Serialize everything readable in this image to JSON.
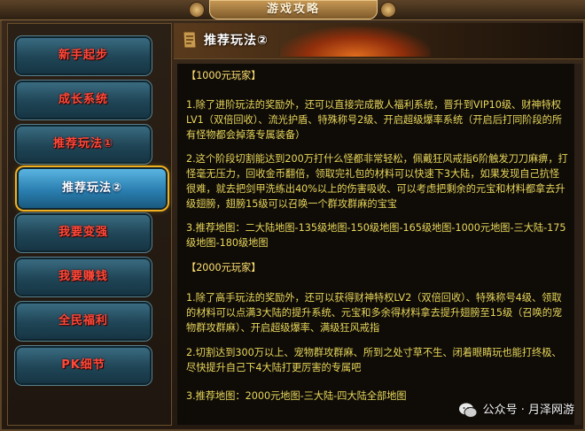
{
  "window": {
    "title": "游戏攻略"
  },
  "sidebar": {
    "items": [
      {
        "label": "新手起步",
        "active": false
      },
      {
        "label": "成长系统",
        "active": false
      },
      {
        "label": "推荐玩法①",
        "active": false
      },
      {
        "label": "推荐玩法②",
        "active": true
      },
      {
        "label": "我要变强",
        "active": false
      },
      {
        "label": "我要赚钱",
        "active": false
      },
      {
        "label": "全民福利",
        "active": false
      },
      {
        "label": "PK细节",
        "active": false
      }
    ]
  },
  "content": {
    "header": "推荐玩法②",
    "tier1": {
      "title": "【1000元玩家】",
      "p1": "1.除了进阶玩法的奖励外，还可以直接完成散人福利系统，晋升到VIP10级、财神特权LV1（双倍回收）、流光护盾、特殊称号2级、开启超级爆率系统（开启后打同阶段的所有怪物都会掉落专属装备）",
      "p2": "2.这个阶段切割能达到200万打什么怪都非常轻松，佩戴狂风戒指6阶触发刀刀麻痹，打怪毫无压力，回收金币翻倍，领取完礼包的材料可以快速下3大陆，如果发现自己抗怪很难，就去把剑甲洗练出40%以上的伤害吸收、可以考虑把剩余的元宝和材料都拿去升级翅膀，翅膀15级可以召唤一个群攻群麻的宝宝",
      "p3": "3.推荐地图：二大陆地图-135级地图-150级地图-165级地图-1000元地图-三大陆-175级地图-180级地图"
    },
    "tier2": {
      "title": "【2000元玩家】",
      "p1": "1.除了高手玩法的奖励外，还可以获得财神特权LV2（双倍回收）、特殊称号4级、领取的材料可以点满3大陆的提升系统、元宝和多余得材料拿去提升翅膀至15级（召唤的宠物群攻群麻）、开启超级爆率、满级狂风戒指",
      "p2": "2.切割达到300万以上、宠物群攻群麻、所到之处寸草不生、闭着眼睛玩也能打终极、尽快提升自己下4大陆打更厉害的专属吧",
      "p3": "3.推荐地图：2000元地图-三大陆-四大陆全部地图"
    }
  },
  "watermark": {
    "text": "公众号 · 月泽网游",
    "icon": "wechat-icon"
  }
}
